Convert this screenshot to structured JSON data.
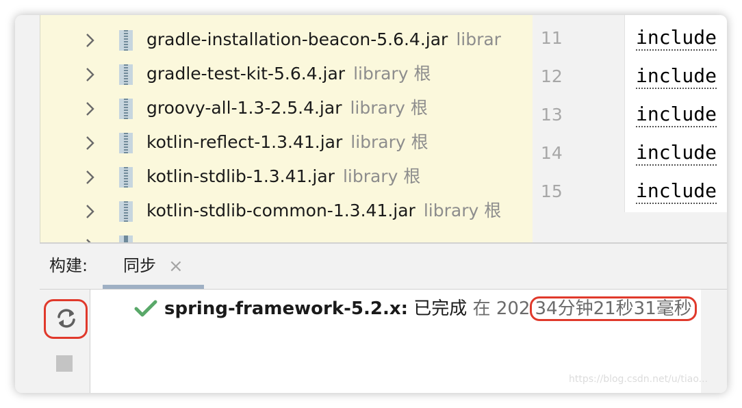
{
  "library_tree": {
    "items": [
      {
        "name": "gradle-installation-beacon-5.6.4.jar",
        "tag": "librar"
      },
      {
        "name": "gradle-test-kit-5.6.4.jar",
        "tag": "library 根"
      },
      {
        "name": "groovy-all-1.3-2.5.4.jar",
        "tag": "library 根"
      },
      {
        "name": "kotlin-reflect-1.3.41.jar",
        "tag": "library 根"
      },
      {
        "name": "kotlin-stdlib-1.3.41.jar",
        "tag": "library 根"
      },
      {
        "name": "kotlin-stdlib-common-1.3.41.jar",
        "tag": "library 根"
      }
    ]
  },
  "editor": {
    "line_numbers": [
      "11",
      "12",
      "13",
      "14",
      "15"
    ],
    "lines": [
      "include",
      "include",
      "include",
      "include",
      "include"
    ]
  },
  "build_panel": {
    "label": "构建:",
    "tab_label": "同步",
    "tab_close": "×"
  },
  "sync_output": {
    "project": "spring-framework-5.2.x:",
    "status": "已完成",
    "at": "在 202",
    "duration": "34分钟21秒31毫秒"
  },
  "icons": [
    "chevron-right-icon",
    "jar-icon",
    "refresh-icon",
    "stop-icon",
    "check-icon"
  ],
  "colors": {
    "highlight": "#e0392b",
    "success": "#59a869",
    "tree_bg": "#fbf8dc",
    "tab_underline": "#9fb0c4"
  },
  "watermark": "https://blog.csdn.net/u/tiao..."
}
